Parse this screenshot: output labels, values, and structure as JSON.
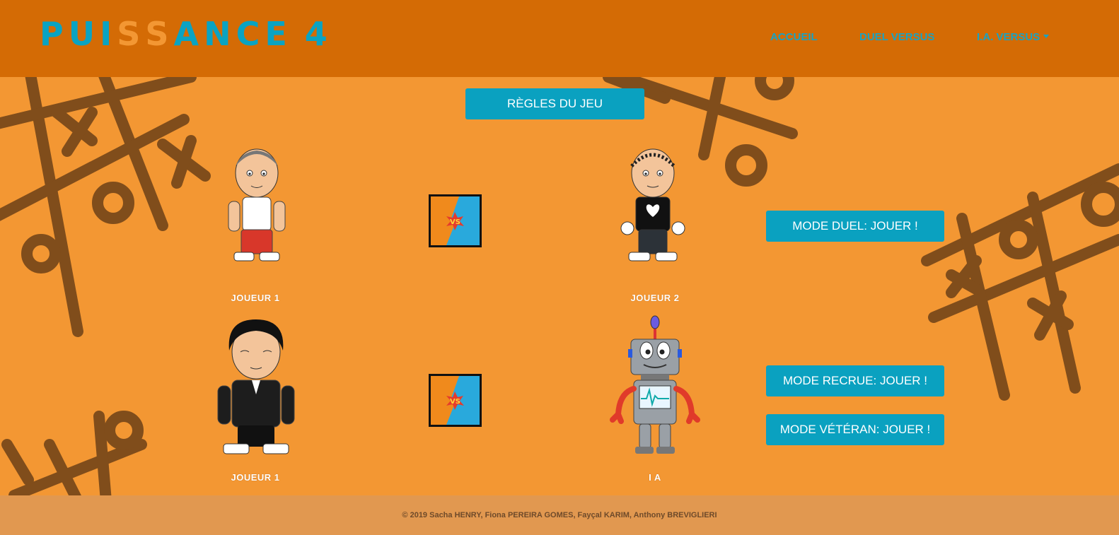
{
  "header": {
    "logo_text": "PUISSANCE 4",
    "nav": {
      "accueil": "ACCUEIL",
      "duel_versus": "DUEL VERSUS",
      "ia_versus": "I.A. VERSUS"
    }
  },
  "main": {
    "rules_button": "RÈGLES DU JEU",
    "duel": {
      "player1_label": "JOUEUR 1",
      "player2_label": "JOUEUR 2",
      "play_button": "MODE DUEL: JOUER !"
    },
    "ia": {
      "player1_label": "JOUEUR 1",
      "ai_label": "I A",
      "recrue_button": "MODE RECRUE: JOUER !",
      "veteran_button": "MODE VÉTÉRAN: JOUER !"
    },
    "vs_icon": "VS"
  },
  "footer": {
    "copyright": "© 2019 Sacha HENRY, Fiona PEREIRA GOMES, Fayçal KARIM, Anthony BREVIGLIERI"
  },
  "colors": {
    "header_bg": "#d46b05",
    "page_bg": "#f39733",
    "accent": "#0aa1c0",
    "footer_bg": "#e19850"
  }
}
